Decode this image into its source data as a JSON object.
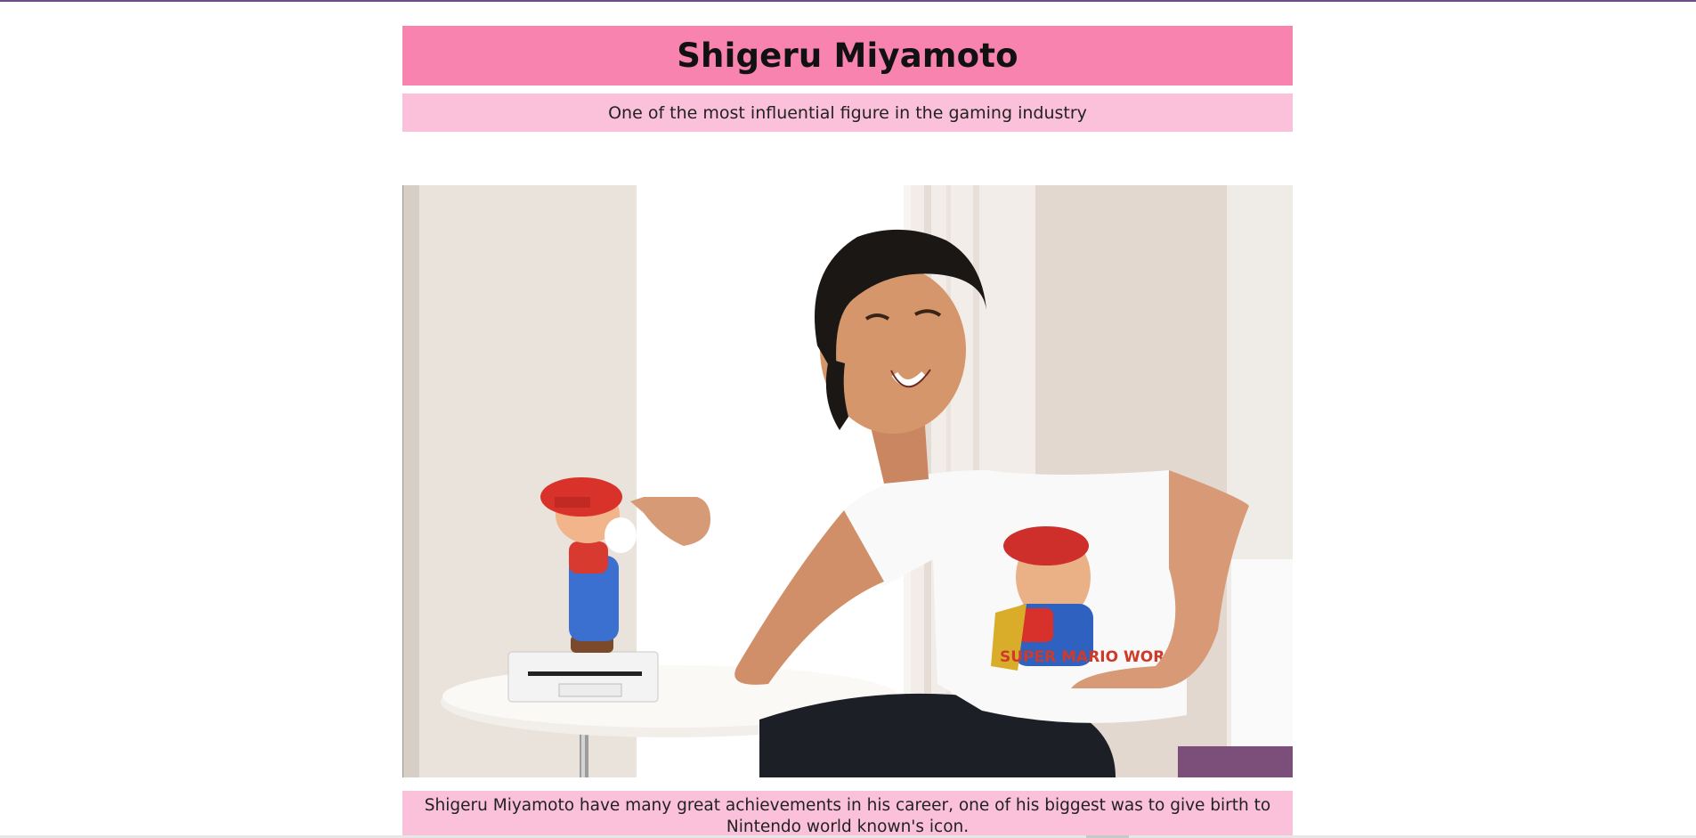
{
  "header": {
    "title": "Shigeru Miyamoto",
    "subtitle": "One of the most influential figure in the gaming industry"
  },
  "main": {
    "image_alt": "Shigeru Miyamoto smiling next to a Mario figurine on a Wii console",
    "caption": "Shigeru Miyamoto have many great achievements in his career, one of his biggest was to give birth to Nintendo world known's icon."
  },
  "colors": {
    "title_bg": "#f783ae",
    "subtitle_bg": "#fbc1da",
    "caption_bg": "#fbc1da",
    "top_border": "#6b4f8a"
  }
}
